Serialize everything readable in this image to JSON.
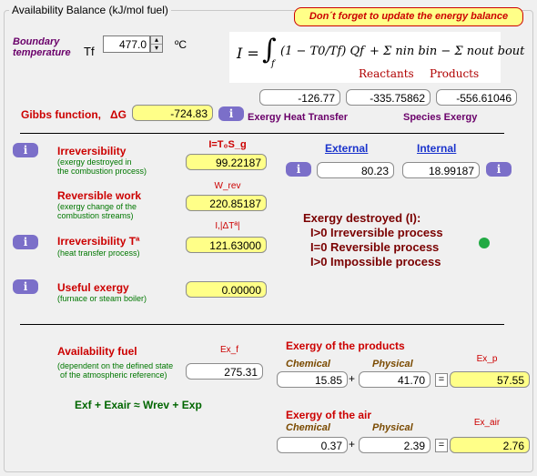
{
  "group_title": "Availability Balance (kJ/mol fuel)",
  "reminder": "Don´t forget to update the energy balance",
  "boundary": {
    "label_line1": "Boundary",
    "label_line2": "temperature",
    "symbol": "Tf",
    "value": "477.0",
    "unit": "ºC"
  },
  "formula": {
    "lhs": "I =",
    "integral": "∫",
    "sub_f": "f",
    "body": "(1 − T0/Tf) Qf",
    "plus": "+ Σ nin bin − Σ nout bout",
    "reactants": "Reactants",
    "products": "Products"
  },
  "exergy_values": {
    "heat_transfer": "-126.77",
    "reactants": "-335.75862",
    "products": "-556.61046",
    "heat_transfer_label": "Exergy Heat Transfer",
    "species_label": "Species Exergy"
  },
  "gibbs": {
    "label": "Gibbs function,",
    "symbol": "ΔG",
    "value": "-724.83"
  },
  "irreversibility": {
    "title": "Irreversibility",
    "desc1": "(exergy destroyed in",
    "desc2": "the combustion process)",
    "symbol": "I=T₀S_g",
    "value": "99.22187",
    "external_label": "External",
    "internal_label": "Internal",
    "external_value": "80.23",
    "internal_value": "18.99187"
  },
  "reversible_work": {
    "title": "Reversible work",
    "desc1": "(exergy change of the",
    "desc2": "combustion streams)",
    "symbol": "W_rev",
    "value": "220.85187"
  },
  "irr_t": {
    "title": "Irreversibility Tª",
    "desc": "(heat transfer process)",
    "symbol": "I,|ΔTª|",
    "value": "121.63000"
  },
  "destroyed": {
    "title": "Exergy destroyed (I):",
    "line1": "I>0 Irreversible process",
    "line2": "I=0 Reversible process",
    "line3": "I>0 Impossible process",
    "indicator_color": "#22aa44"
  },
  "useful": {
    "title": "Useful exergy",
    "desc": "(furnace or steam boiler)",
    "value": "0.00000"
  },
  "availability_fuel": {
    "title": "Availability fuel",
    "desc1": "(dependent on the defined state",
    "desc2": "of the atmospheric reference)",
    "symbol": "Ex_f",
    "value": "275.31"
  },
  "equation": "Exf + Exair ≈ Wrev + Exp",
  "products": {
    "title": "Exergy of the products",
    "chemical_label": "Chemical",
    "physical_label": "Physical",
    "chemical": "15.85",
    "physical": "41.70",
    "symbol": "Ex_p",
    "total": "57.55"
  },
  "air": {
    "title": "Exergy of the air",
    "chemical_label": "Chemical",
    "physical_label": "Physical",
    "chemical": "0.37",
    "physical": "2.39",
    "symbol": "Ex_air",
    "total": "2.76"
  },
  "plus": "+",
  "equals": "=",
  "info_label": "i",
  "spin_up": "▴",
  "spin_down": "▾"
}
